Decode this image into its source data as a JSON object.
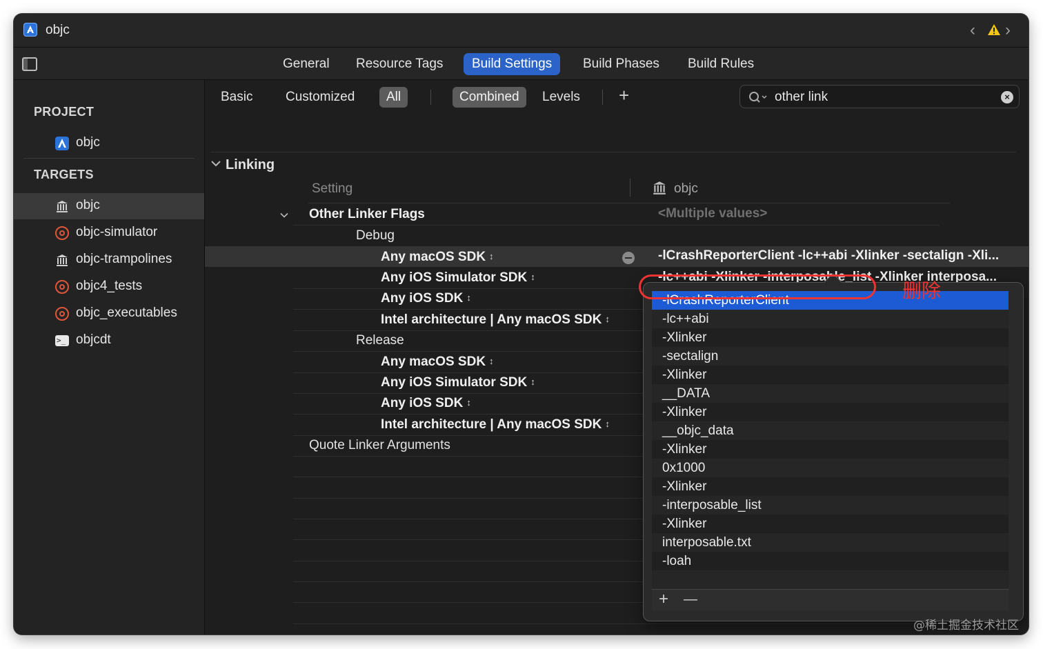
{
  "window": {
    "title": "objc"
  },
  "tabs": [
    "General",
    "Resource Tags",
    "Build Settings",
    "Build Phases",
    "Build Rules"
  ],
  "sidebar": {
    "project_heading": "PROJECT",
    "project_item": "objc",
    "targets_heading": "TARGETS",
    "targets": [
      "objc",
      "objc-simulator",
      "objc-trampolines",
      "objc4_tests",
      "objc_executables",
      "objcdt"
    ]
  },
  "filter": {
    "basic": "Basic",
    "customized": "Customized",
    "all": "All",
    "combined": "Combined",
    "levels": "Levels",
    "add": "+"
  },
  "search": {
    "value": "other link"
  },
  "settings": {
    "section": "Linking",
    "col_setting": "Setting",
    "col_target": "objc",
    "other_linker_flags": "Other Linker Flags",
    "multiple_values": "<Multiple values>",
    "debug": "Debug",
    "release": "Release",
    "debug_rows": [
      {
        "label": "Any macOS SDK",
        "value": "-lCrashReporterClient -lc++abi -Xlinker -sectalign -Xli..."
      },
      {
        "label": "Any iOS Simulator SDK",
        "value": "-lc++abi -Xlinker -interposable_list -Xlinker interposa..."
      },
      {
        "label": "Any iOS SDK",
        "value": ""
      },
      {
        "label": "Intel architecture | Any macOS SDK",
        "value": ""
      }
    ],
    "release_rows": [
      {
        "label": "Any macOS SDK"
      },
      {
        "label": "Any iOS Simulator SDK"
      },
      {
        "label": "Any iOS SDK"
      },
      {
        "label": "Intel architecture | Any macOS SDK"
      }
    ],
    "quote_linker": "Quote Linker Arguments"
  },
  "popover": {
    "items": [
      "-lCrashReporterClient",
      "-lc++abi",
      "-Xlinker",
      "-sectalign",
      "-Xlinker",
      "__DATA",
      "-Xlinker",
      "__objc_data",
      "-Xlinker",
      "0x1000",
      "-Xlinker",
      "-interposable_list",
      "-Xlinker",
      "interposable.txt",
      "-loah"
    ],
    "add": "+",
    "remove": "—"
  },
  "annotation": "删除",
  "watermark": "@稀土掘金技术社区"
}
